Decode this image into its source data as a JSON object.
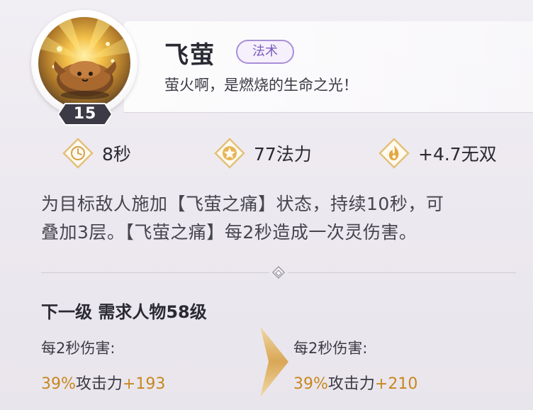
{
  "skill": {
    "name": "飞萤",
    "type_tag": "法术",
    "subtitle": "萤火啊，是燃烧的生命之光！",
    "level": "15"
  },
  "stats": {
    "cooldown": "8秒",
    "mana": "77法力",
    "bonus": "+4.7无双"
  },
  "description": {
    "line1": "为目标敌人施加【飞萤之痛】状态，持续10秒，可",
    "line2": "叠加3层。【飞萤之痛】每2秒造成一次灵伤害。"
  },
  "next_level": {
    "title": "下一级 需求人物58级",
    "current": {
      "label": "每2秒伤害:",
      "percent": "39%",
      "mid": "攻击力",
      "plus": "+193"
    },
    "next": {
      "label": "每2秒伤害:",
      "percent": "39%",
      "mid": "攻击力",
      "plus": "+210"
    }
  },
  "colors": {
    "accent_gold": "#c8871f",
    "tag_purple": "#7b5bbf"
  },
  "icons": {
    "cooldown": "clock-icon",
    "mana": "star-icon",
    "bonus": "flame-icon",
    "divider": "diamond-icon",
    "arrow": "chevron-right-icon"
  }
}
